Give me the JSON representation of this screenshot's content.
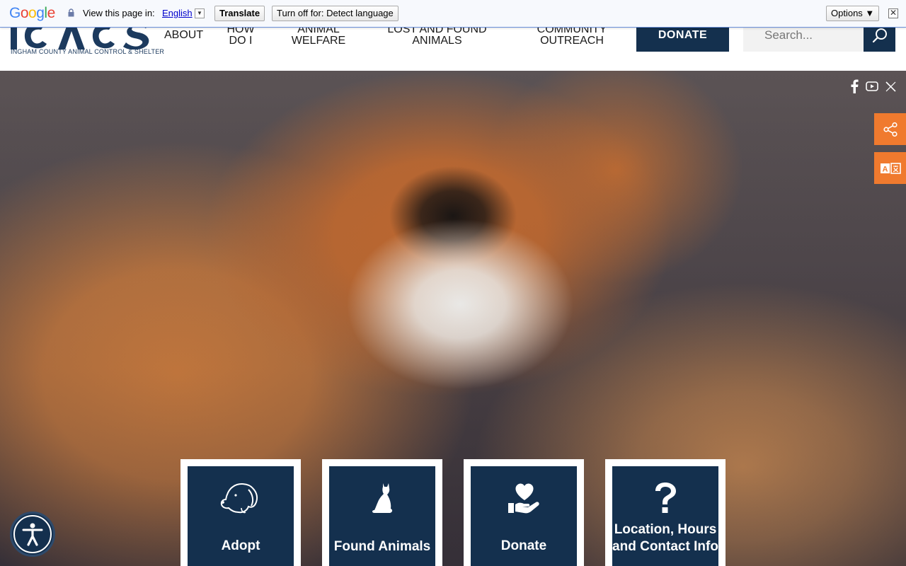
{
  "translate_bar": {
    "logo": "Google",
    "view_label": "View this page in:",
    "language": "English",
    "translate_button": "Translate",
    "turn_off_button": "Turn off for: Detect language",
    "options_button": "Options ▼",
    "close_icon": "close-icon"
  },
  "header": {
    "logo_text": "INGHAM COUNTY ANIMAL CONTROL & SHELTER",
    "nav": [
      {
        "label": "ABOUT"
      },
      {
        "label": "HOW\nDO I"
      },
      {
        "label": "ANIMAL\nWELFARE"
      },
      {
        "label": "LOST AND FOUND\nANIMALS"
      },
      {
        "label": "COMMUNITY\nOUTREACH"
      }
    ],
    "donate_label": "DONATE",
    "search_placeholder": "Search..."
  },
  "hero": {
    "social": [
      "facebook-icon",
      "youtube-icon",
      "x-twitter-icon"
    ],
    "side_buttons": [
      "share-icon",
      "translate-icon"
    ]
  },
  "cards": [
    {
      "label": "Adopt",
      "icon": "dog-icon"
    },
    {
      "label": "Found Animals",
      "icon": "cat-icon"
    },
    {
      "label": "Donate",
      "icon": "heart-hand-icon"
    },
    {
      "label": "Location, Hours and Contact Info",
      "icon": "question-icon"
    }
  ],
  "colors": {
    "navy": "#14304e",
    "orange": "#f07a2e"
  }
}
